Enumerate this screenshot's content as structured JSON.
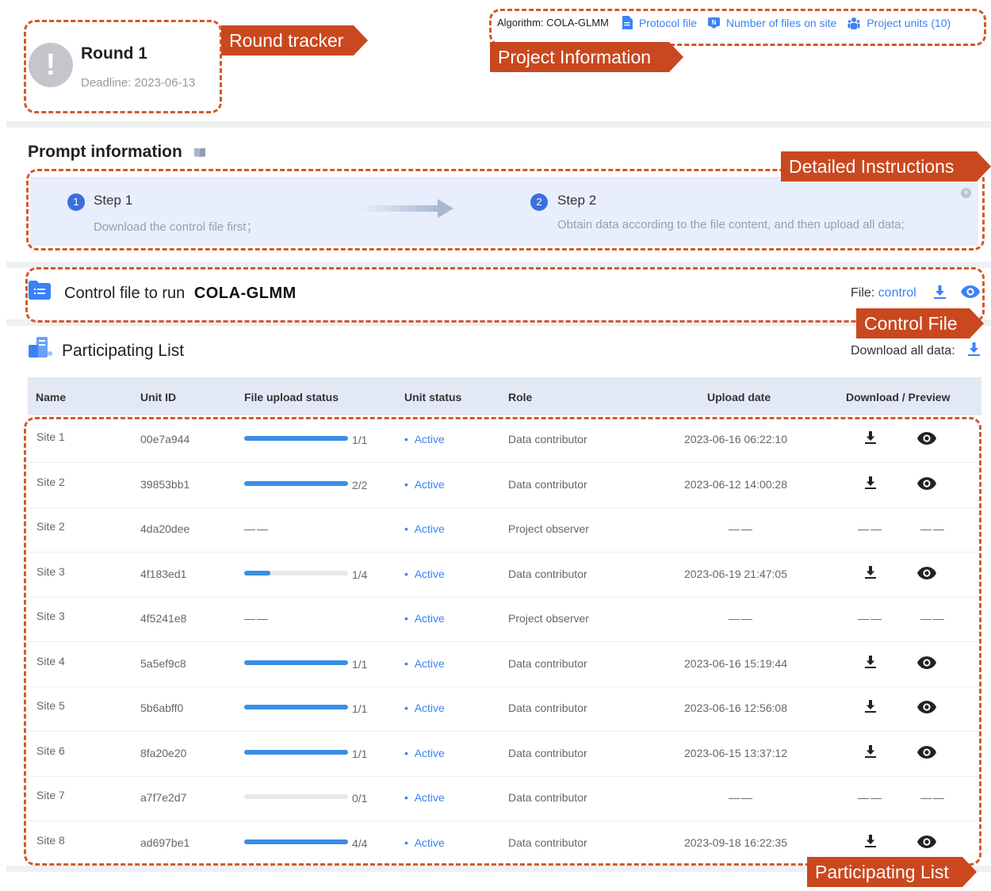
{
  "annotations": {
    "round_tracker": "Round tracker",
    "project_information": "Project Information",
    "detailed_instructions": "Detailed Instructions",
    "control_file": "Control File",
    "participating_list": "Participating List"
  },
  "round": {
    "icon": "exclamation-icon",
    "title": "Round 1",
    "deadline": "Deadline: 2023-06-13"
  },
  "project_info": {
    "algorithm": "Algorithm: COLA-GLMM",
    "protocol_file": "Protocol file",
    "files_on_site": "Number of files on site",
    "project_units": "Project units (10)"
  },
  "prompt": {
    "title": "Prompt information",
    "steps": [
      {
        "num": "1",
        "title": "Step 1",
        "desc": "Download the control file first；"
      },
      {
        "num": "2",
        "title": "Step 2",
        "desc": "Obtain data according to the file content, and then upload all data;"
      }
    ]
  },
  "control": {
    "title": "Control file to run",
    "algorithm": "COLA-GLMM",
    "file_label": "File: ",
    "file_link": "control"
  },
  "participating": {
    "title": "Participating List",
    "download_all": "Download all data:",
    "headers": [
      "Name",
      "Unit ID",
      "File upload status",
      "Unit status",
      "Role",
      "Upload date",
      "Download / Preview"
    ],
    "rows": [
      {
        "name": "Site 1",
        "unit_id": "00e7a944",
        "progress": 1.0,
        "upload": "1/1",
        "status": "Active",
        "role": "Data contributor",
        "date": "2023-06-16 06:22:10",
        "actions": true
      },
      {
        "name": "Site 2",
        "unit_id": "39853bb1",
        "progress": 1.0,
        "upload": "2/2",
        "status": "Active",
        "role": "Data contributor",
        "date": "2023-06-12 14:00:28",
        "actions": true
      },
      {
        "name": "Site 2",
        "unit_id": "4da20dee",
        "progress": null,
        "upload": "——",
        "status": "Active",
        "role": "Project observer",
        "date": "——",
        "actions": false
      },
      {
        "name": "Site 3",
        "unit_id": "4f183ed1",
        "progress": 0.25,
        "upload": "1/4",
        "status": "Active",
        "role": "Data contributor",
        "date": "2023-06-19 21:47:05",
        "actions": true
      },
      {
        "name": "Site 3",
        "unit_id": "4f5241e8",
        "progress": null,
        "upload": "——",
        "status": "Active",
        "role": "Project observer",
        "date": "——",
        "actions": false
      },
      {
        "name": "Site 4",
        "unit_id": "5a5ef9c8",
        "progress": 1.0,
        "upload": "1/1",
        "status": "Active",
        "role": "Data contributor",
        "date": "2023-06-16 15:19:44",
        "actions": true
      },
      {
        "name": "Site 5",
        "unit_id": "5b6abff0",
        "progress": 1.0,
        "upload": "1/1",
        "status": "Active",
        "role": "Data contributor",
        "date": "2023-06-16 12:56:08",
        "actions": true
      },
      {
        "name": "Site 6",
        "unit_id": "8fa20e20",
        "progress": 1.0,
        "upload": "1/1",
        "status": "Active",
        "role": "Data contributor",
        "date": "2023-06-15 13:37:12",
        "actions": true
      },
      {
        "name": "Site 7",
        "unit_id": "a7f7e2d7",
        "progress": 0.0,
        "upload": "0/1",
        "status": "Active",
        "role": "Data contributor",
        "date": "——",
        "actions": false
      },
      {
        "name": "Site 8",
        "unit_id": "ad697be1",
        "progress": 1.0,
        "upload": "4/4",
        "status": "Active",
        "role": "Data contributor",
        "date": "2023-09-18 16:22:35",
        "actions": true
      }
    ],
    "empty_action": "——"
  },
  "colors": {
    "accent": "#3b82f6",
    "annotation": "#c9481f",
    "dashed": "#d4582c",
    "header_bg": "#e3e8f5"
  }
}
